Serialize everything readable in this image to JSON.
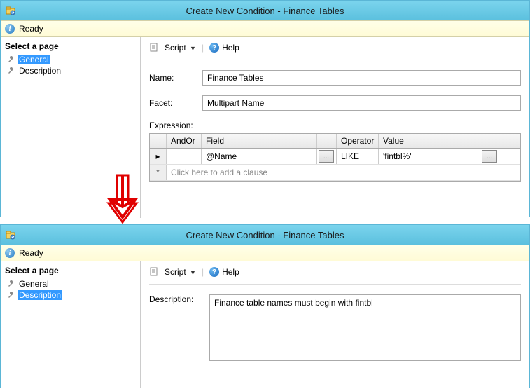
{
  "window1": {
    "title": "Create New Condition - Finance Tables",
    "status": "Ready",
    "sidebar": {
      "header": "Select a page",
      "items": [
        {
          "label": "General",
          "selected": true
        },
        {
          "label": "Description",
          "selected": false
        }
      ]
    },
    "toolbar": {
      "script_label": "Script",
      "help_label": "Help"
    },
    "form": {
      "name_label": "Name:",
      "name_value": "Finance Tables",
      "facet_label": "Facet:",
      "facet_value": "Multipart Name",
      "expression_label": "Expression:",
      "grid": {
        "headers": {
          "andor": "AndOr",
          "field": "Field",
          "operator": "Operator",
          "value": "Value"
        },
        "rows": [
          {
            "andor": "",
            "field": "@Name",
            "operator": "LIKE",
            "value": "'fintbl%'"
          }
        ],
        "add_text": "Click here to add a clause"
      }
    }
  },
  "window2": {
    "title": "Create New Condition - Finance Tables",
    "status": "Ready",
    "sidebar": {
      "header": "Select a page",
      "items": [
        {
          "label": "General",
          "selected": false
        },
        {
          "label": "Description",
          "selected": true
        }
      ]
    },
    "toolbar": {
      "script_label": "Script",
      "help_label": "Help"
    },
    "form": {
      "description_label": "Description:",
      "description_value": "Finance table names must begin with fintbl"
    }
  },
  "icons": {
    "ellipsis": "..."
  }
}
